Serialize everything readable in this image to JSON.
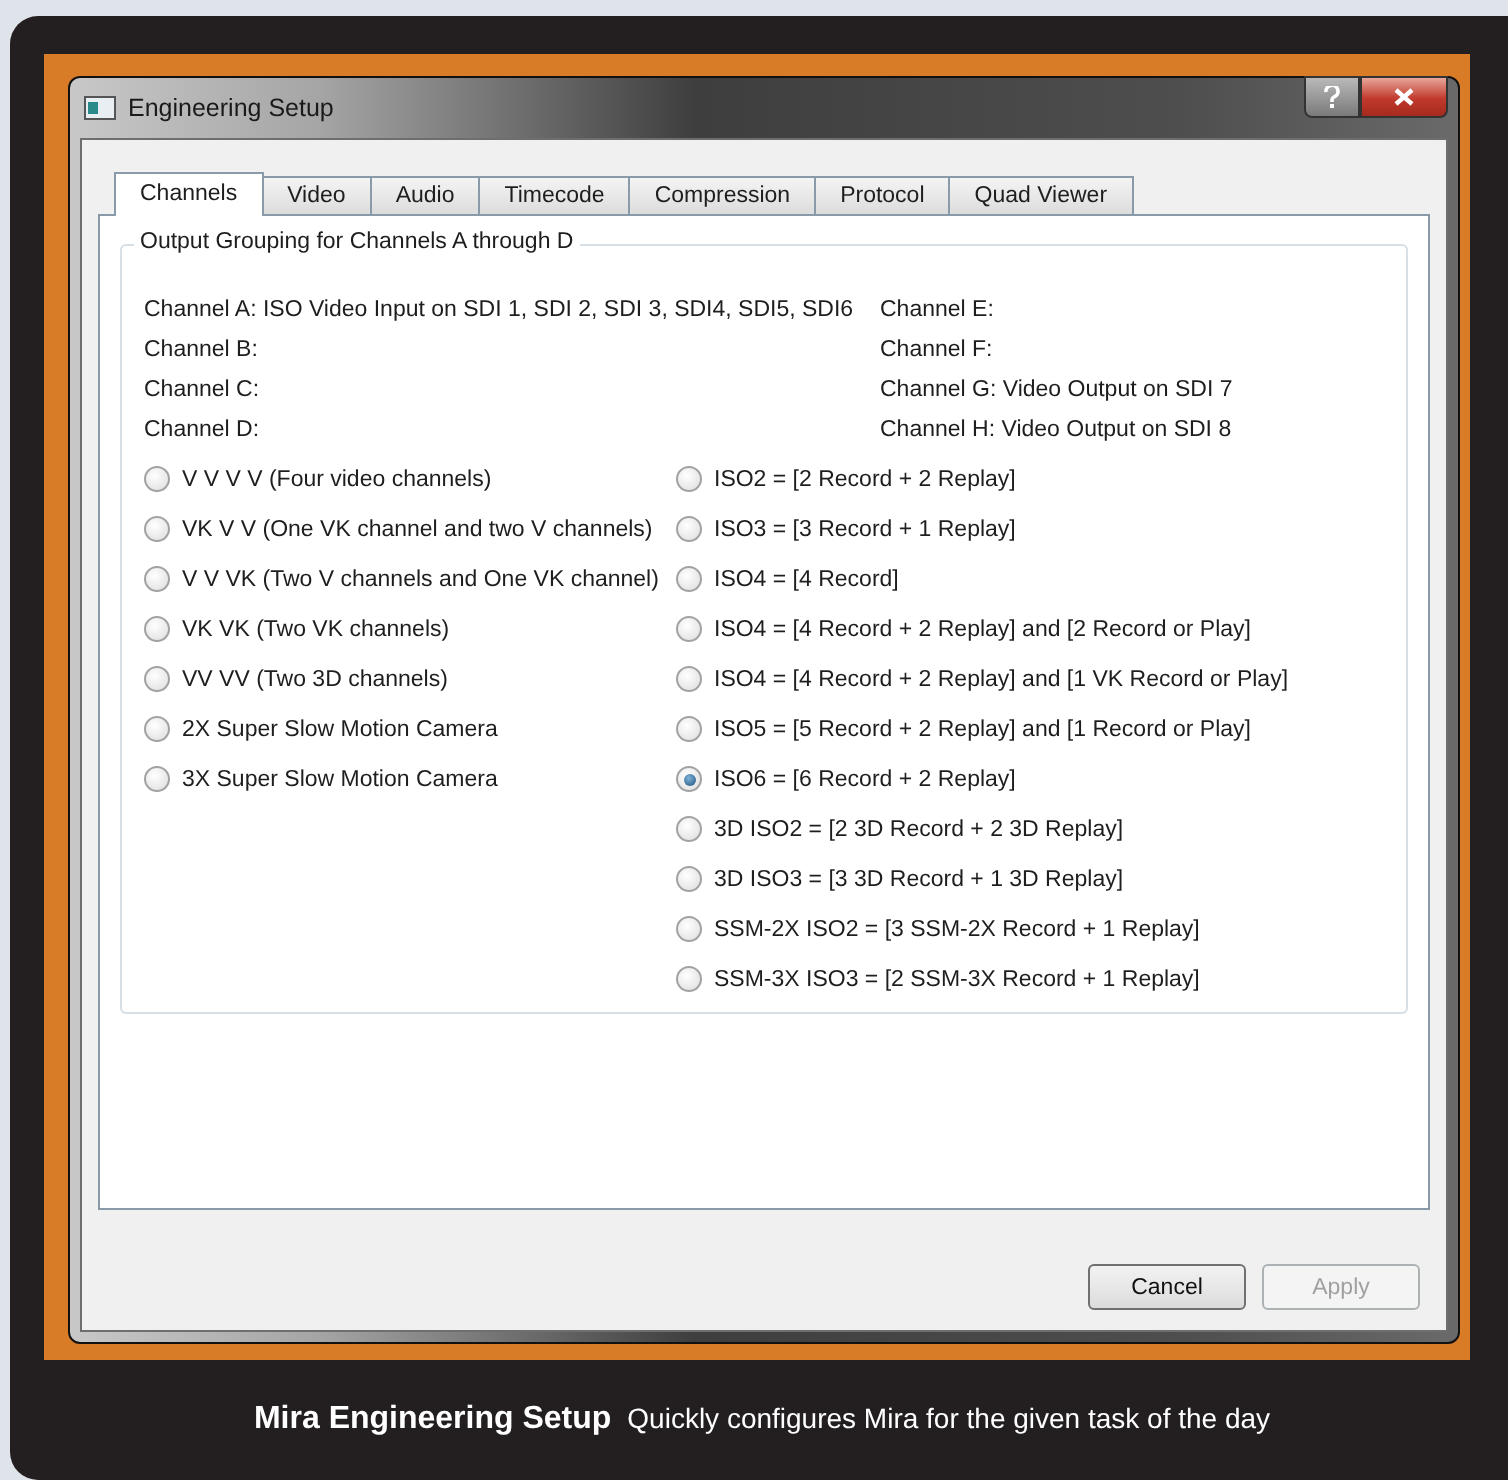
{
  "window": {
    "title": "Engineering Setup"
  },
  "tabs": [
    {
      "label": "Channels",
      "selected": true
    },
    {
      "label": "Video",
      "selected": false
    },
    {
      "label": "Audio",
      "selected": false
    },
    {
      "label": "Timecode",
      "selected": false
    },
    {
      "label": "Compression",
      "selected": false
    },
    {
      "label": "Protocol",
      "selected": false
    },
    {
      "label": "Quad Viewer",
      "selected": false
    }
  ],
  "group": {
    "title": "Output Grouping for Channels A through D",
    "channels_left": [
      "Channel A: ISO Video Input on SDI 1, SDI 2, SDI 3, SDI4, SDI5, SDI6",
      "Channel B:",
      "Channel C:",
      "Channel D:"
    ],
    "channels_right": [
      "Channel E:",
      "Channel F:",
      "Channel G: Video Output on SDI 7",
      "Channel H: Video Output on SDI 8"
    ],
    "options_left": [
      {
        "label": "V V V V (Four video channels)",
        "selected": false
      },
      {
        "label": "VK V V (One VK channel and two V channels)",
        "selected": false
      },
      {
        "label": "V V VK (Two V channels and One VK channel)",
        "selected": false
      },
      {
        "label": "VK VK (Two VK channels)",
        "selected": false
      },
      {
        "label": "VV VV (Two 3D channels)",
        "selected": false
      },
      {
        "label": "2X Super Slow Motion Camera",
        "selected": false
      },
      {
        "label": "3X Super Slow Motion Camera",
        "selected": false
      }
    ],
    "options_right": [
      {
        "label": "ISO2 = [2 Record + 2 Replay]",
        "selected": false
      },
      {
        "label": "ISO3 = [3 Record + 1 Replay]",
        "selected": false
      },
      {
        "label": "ISO4 = [4 Record]",
        "selected": false
      },
      {
        "label": "ISO4 = [4 Record + 2 Replay] and [2 Record or Play]",
        "selected": false
      },
      {
        "label": "ISO4 = [4 Record + 2 Replay] and [1 VK Record or Play]",
        "selected": false
      },
      {
        "label": "ISO5 = [5 Record + 2 Replay] and [1 Record or Play]",
        "selected": false
      },
      {
        "label": "ISO6 = [6 Record + 2 Replay]",
        "selected": true
      },
      {
        "label": "3D ISO2 = [2 3D Record + 2 3D Replay]",
        "selected": false
      },
      {
        "label": "3D ISO3 = [3 3D Record + 1 3D Replay]",
        "selected": false
      },
      {
        "label": "SSM-2X ISO2 = [3 SSM-2X Record + 1 Replay]",
        "selected": false
      },
      {
        "label": "SSM-3X ISO3 = [2 SSM-3X Record + 1 Replay]",
        "selected": false
      }
    ]
  },
  "buttons": [
    {
      "label": "Cancel",
      "disabled": false
    },
    {
      "label": "Apply",
      "disabled": true
    }
  ],
  "caption": {
    "title": "Mira Engineering Setup",
    "text": "Quickly configures Mira for the given task of the day"
  }
}
